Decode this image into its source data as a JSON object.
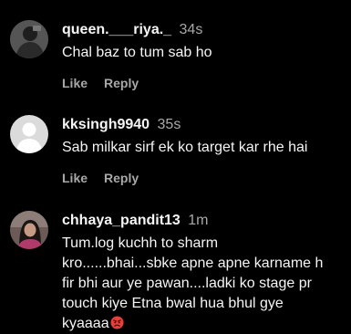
{
  "comments": [
    {
      "username": "queen.___riya._",
      "time": "34s",
      "text": "Chal baz to tum sab ho",
      "like_label": "Like",
      "reply_label": "Reply"
    },
    {
      "username": "kksingh9940",
      "time": "35s",
      "text": "Sab milkar sirf ek ko target kar rhe hai",
      "like_label": "Like",
      "reply_label": "Reply"
    },
    {
      "username": "chhaya_pandit13",
      "time": "1m",
      "text": "Tum.log kuchh to sharm\nkro......bhai...sbke apne apne karname h\nfir bhi aur ye pawan....ladki ko stage pr\ntouch kiye Etna bwal hua bhul gye\nkyaaaa"
    }
  ],
  "icons": {
    "comment3_trailing": "angry-face-emoji-icon"
  },
  "colors": {
    "background": "#000000",
    "primary_text": "#f5f5f5",
    "secondary_text": "#a8a8a8",
    "emoji_red": "#e5403a"
  }
}
